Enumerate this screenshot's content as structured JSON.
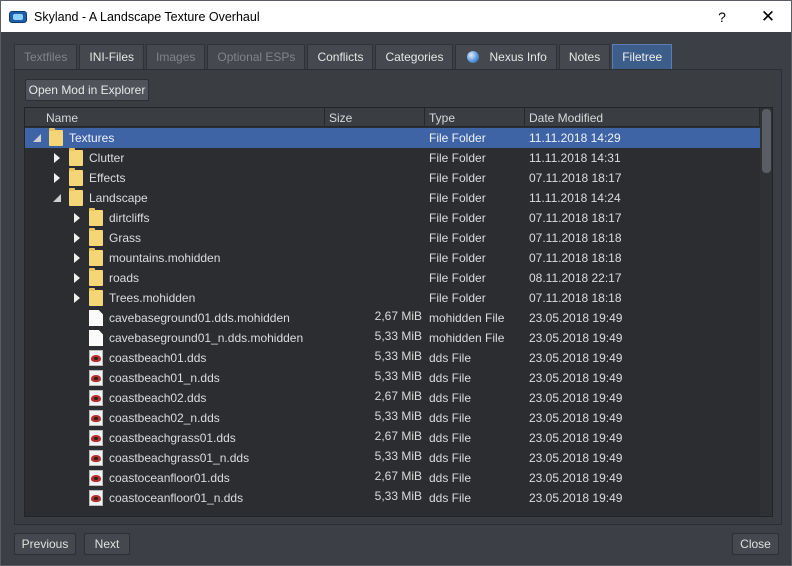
{
  "window": {
    "title": "Skyland - A Landscape Texture Overhaul",
    "help_glyph": "?",
    "close_glyph": "✕"
  },
  "tabs": [
    {
      "label": "Textfiles",
      "state": "disabled"
    },
    {
      "label": "INI-Files",
      "state": "normal"
    },
    {
      "label": "Images",
      "state": "disabled"
    },
    {
      "label": "Optional ESPs",
      "state": "disabled"
    },
    {
      "label": "Conflicts",
      "state": "normal"
    },
    {
      "label": "Categories",
      "state": "normal"
    },
    {
      "label": "Nexus Info",
      "state": "normal",
      "icon": "globe-icon"
    },
    {
      "label": "Notes",
      "state": "normal"
    },
    {
      "label": "Filetree",
      "state": "active"
    }
  ],
  "toolbar": {
    "open_explorer_label": "Open Mod in Explorer"
  },
  "columns": {
    "name": "Name",
    "size": "Size",
    "type": "Type",
    "date": "Date Modified"
  },
  "rows": [
    {
      "name": "Textures",
      "size": "",
      "type": "File Folder",
      "date": "11.11.2018 14:29",
      "depth": 0,
      "kind": "folder",
      "expander": "expanded",
      "selected": true
    },
    {
      "name": "Clutter",
      "size": "",
      "type": "File Folder",
      "date": "11.11.2018 14:31",
      "depth": 1,
      "kind": "folder",
      "expander": "collapsed"
    },
    {
      "name": "Effects",
      "size": "",
      "type": "File Folder",
      "date": "07.11.2018 18:17",
      "depth": 1,
      "kind": "folder",
      "expander": "collapsed"
    },
    {
      "name": "Landscape",
      "size": "",
      "type": "File Folder",
      "date": "11.11.2018 14:24",
      "depth": 1,
      "kind": "folder",
      "expander": "expanded"
    },
    {
      "name": "dirtcliffs",
      "size": "",
      "type": "File Folder",
      "date": "07.11.2018 18:17",
      "depth": 2,
      "kind": "folder",
      "expander": "collapsed"
    },
    {
      "name": "Grass",
      "size": "",
      "type": "File Folder",
      "date": "07.11.2018 18:18",
      "depth": 2,
      "kind": "folder",
      "expander": "collapsed"
    },
    {
      "name": "mountains.mohidden",
      "size": "",
      "type": "File Folder",
      "date": "07.11.2018 18:18",
      "depth": 2,
      "kind": "folder",
      "expander": "collapsed"
    },
    {
      "name": "roads",
      "size": "",
      "type": "File Folder",
      "date": "08.11.2018 22:17",
      "depth": 2,
      "kind": "folder",
      "expander": "collapsed"
    },
    {
      "name": "Trees.mohidden",
      "size": "",
      "type": "File Folder",
      "date": "07.11.2018 18:18",
      "depth": 2,
      "kind": "folder",
      "expander": "collapsed"
    },
    {
      "name": "cavebaseground01.dds.mohidden",
      "size": "2,67 MiB",
      "type": "mohidden File",
      "date": "23.05.2018 19:49",
      "depth": 2,
      "kind": "file",
      "expander": "none"
    },
    {
      "name": "cavebaseground01_n.dds.mohidden",
      "size": "5,33 MiB",
      "type": "mohidden File",
      "date": "23.05.2018 19:49",
      "depth": 2,
      "kind": "file",
      "expander": "none"
    },
    {
      "name": "coastbeach01.dds",
      "size": "5,33 MiB",
      "type": "dds File",
      "date": "23.05.2018 19:49",
      "depth": 2,
      "kind": "dds",
      "expander": "none"
    },
    {
      "name": "coastbeach01_n.dds",
      "size": "5,33 MiB",
      "type": "dds File",
      "date": "23.05.2018 19:49",
      "depth": 2,
      "kind": "dds",
      "expander": "none"
    },
    {
      "name": "coastbeach02.dds",
      "size": "2,67 MiB",
      "type": "dds File",
      "date": "23.05.2018 19:49",
      "depth": 2,
      "kind": "dds",
      "expander": "none"
    },
    {
      "name": "coastbeach02_n.dds",
      "size": "5,33 MiB",
      "type": "dds File",
      "date": "23.05.2018 19:49",
      "depth": 2,
      "kind": "dds",
      "expander": "none"
    },
    {
      "name": "coastbeachgrass01.dds",
      "size": "2,67 MiB",
      "type": "dds File",
      "date": "23.05.2018 19:49",
      "depth": 2,
      "kind": "dds",
      "expander": "none"
    },
    {
      "name": "coastbeachgrass01_n.dds",
      "size": "5,33 MiB",
      "type": "dds File",
      "date": "23.05.2018 19:49",
      "depth": 2,
      "kind": "dds",
      "expander": "none"
    },
    {
      "name": "coastoceanfloor01.dds",
      "size": "2,67 MiB",
      "type": "dds File",
      "date": "23.05.2018 19:49",
      "depth": 2,
      "kind": "dds",
      "expander": "none"
    },
    {
      "name": "coastoceanfloor01_n.dds",
      "size": "5,33 MiB",
      "type": "dds File",
      "date": "23.05.2018 19:49",
      "depth": 2,
      "kind": "dds",
      "expander": "none"
    }
  ],
  "footer": {
    "previous_label": "Previous",
    "next_label": "Next",
    "close_label": "Close"
  }
}
